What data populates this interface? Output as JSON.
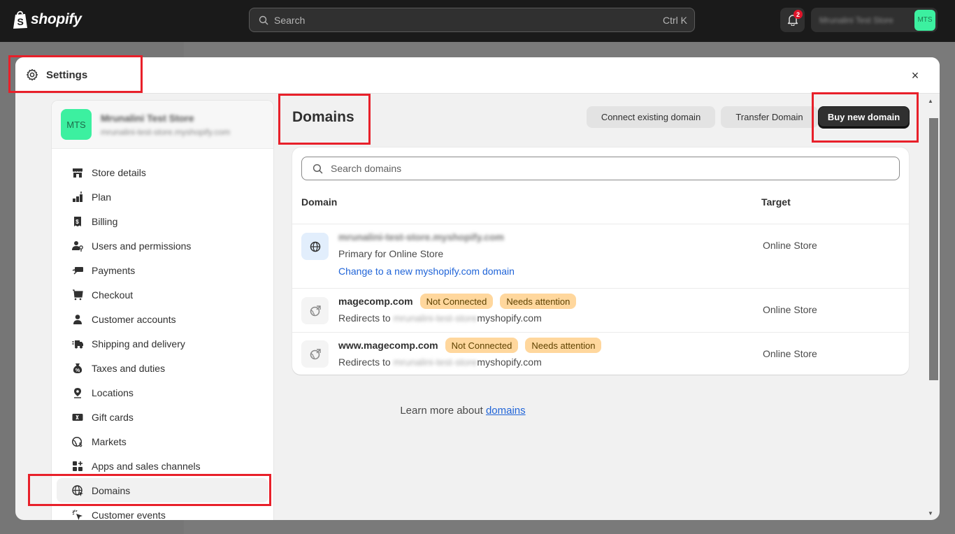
{
  "topbar": {
    "brand": "shopify",
    "search_placeholder": "Search",
    "search_shortcut": "Ctrl K",
    "notifications_count": "2",
    "account_name": "Mrunalini Test Store",
    "account_initials": "MTS"
  },
  "modal": {
    "title": "Settings",
    "close_label": "×"
  },
  "store": {
    "initials": "MTS",
    "name": "Mrunalini Test Store",
    "url": "mrunalini-test-store.myshopify.com"
  },
  "sidebar": {
    "items": [
      {
        "label": "Store details",
        "icon": "store-icon"
      },
      {
        "label": "Plan",
        "icon": "plan-icon"
      },
      {
        "label": "Billing",
        "icon": "billing-icon"
      },
      {
        "label": "Users and permissions",
        "icon": "users-icon"
      },
      {
        "label": "Payments",
        "icon": "payments-icon"
      },
      {
        "label": "Checkout",
        "icon": "cart-icon"
      },
      {
        "label": "Customer accounts",
        "icon": "person-icon"
      },
      {
        "label": "Shipping and delivery",
        "icon": "truck-icon"
      },
      {
        "label": "Taxes and duties",
        "icon": "tax-icon"
      },
      {
        "label": "Locations",
        "icon": "location-icon"
      },
      {
        "label": "Gift cards",
        "icon": "gift-card-icon"
      },
      {
        "label": "Markets",
        "icon": "markets-icon"
      },
      {
        "label": "Apps and sales channels",
        "icon": "apps-icon"
      },
      {
        "label": "Domains",
        "icon": "globe-icon",
        "active": true
      },
      {
        "label": "Customer events",
        "icon": "cursor-click-icon"
      }
    ]
  },
  "main": {
    "title": "Domains",
    "actions": {
      "connect": "Connect existing domain",
      "transfer": "Transfer Domain",
      "buy": "Buy new domain"
    },
    "search_placeholder": "Search domains",
    "columns": {
      "domain": "Domain",
      "target": "Target"
    },
    "rows": [
      {
        "domain": "mrunalini-test-store.myshopify.com",
        "subtitle": "Primary for Online Store",
        "link": "Change to a new myshopify.com domain",
        "target": "Online Store"
      },
      {
        "domain": "magecomp.com",
        "badges": [
          "Not Connected",
          "Needs attention"
        ],
        "redirect_prefix": "Redirects to",
        "redirect_hidden": "mrunalini-test-store",
        "redirect_suffix": "myshopify.com",
        "target": "Online Store"
      },
      {
        "domain": "www.magecomp.com",
        "badges": [
          "Not Connected",
          "Needs attention"
        ],
        "redirect_prefix": "Redirects to",
        "redirect_hidden": "mrunalini-test-store",
        "redirect_suffix": "myshopify.com",
        "target": "Online Store"
      }
    ],
    "learn_more_prefix": "Learn more about",
    "learn_more_link": "domains"
  },
  "colors": {
    "topbar": "#1a1a1a",
    "accent_green": "#3cf0a0",
    "badge_warning": "#ffd79d",
    "link": "#2165d8",
    "primary_button": "#303030",
    "annotation": "#e8202a"
  }
}
